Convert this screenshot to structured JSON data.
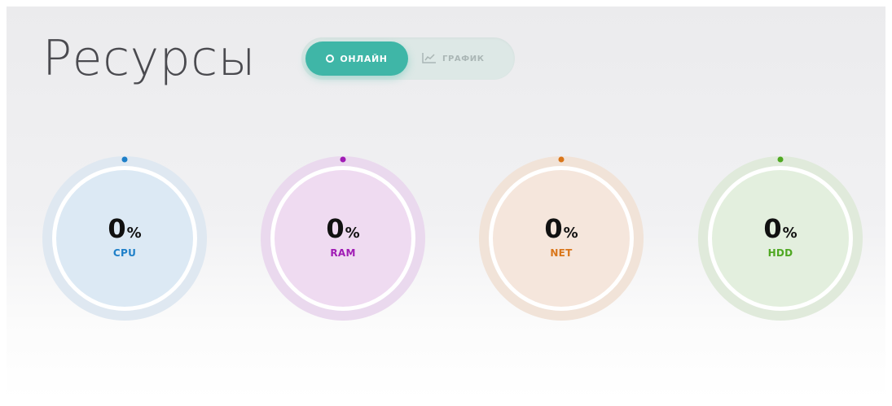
{
  "header": {
    "title": "Ресурсы"
  },
  "toggle": {
    "online_label": "ОНЛАЙН",
    "graph_label": "ГРАФИК",
    "active": "online",
    "active_color": "#3fb6a7",
    "icons": {
      "online": "circle-icon",
      "graph": "line-chart-icon"
    }
  },
  "gauges": [
    {
      "name": "CPU",
      "value": "0",
      "unit": "%",
      "color": "#1e7fc8",
      "fill": "#dce9f4",
      "ring": "#dfe8f1"
    },
    {
      "name": "RAM",
      "value": "0",
      "unit": "%",
      "color": "#a01cb5",
      "fill": "#efdbf1",
      "ring": "#ead9ee"
    },
    {
      "name": "NET",
      "value": "0",
      "unit": "%",
      "color": "#d9761a",
      "fill": "#f5e6dc",
      "ring": "#f1e3d8"
    },
    {
      "name": "HDD",
      "value": "0",
      "unit": "%",
      "color": "#4fa822",
      "fill": "#e3efde",
      "ring": "#e0eadb"
    }
  ]
}
